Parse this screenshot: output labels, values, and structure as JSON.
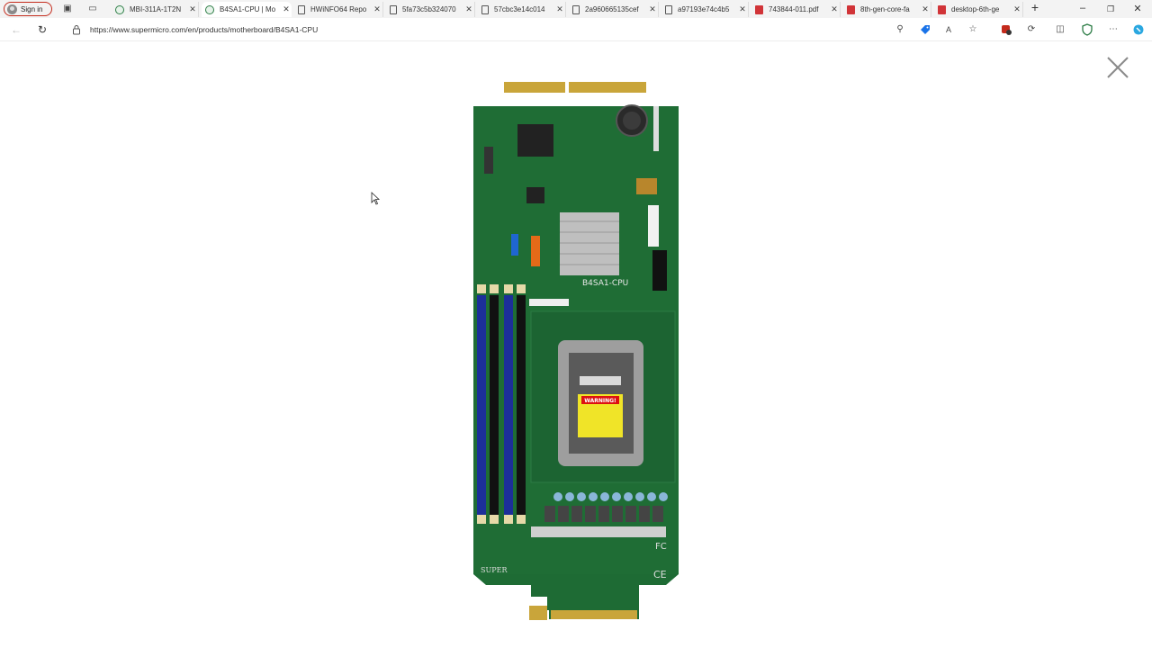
{
  "browser": {
    "signin_label": "Sign in",
    "tabs": [
      {
        "label": "MBI-311A-1T2N",
        "icon": "globe"
      },
      {
        "label": "B4SA1-CPU | Mo",
        "icon": "globe",
        "active": true
      },
      {
        "label": "HWiNFO64 Repo",
        "icon": "doc"
      },
      {
        "label": "5fa73c5b324070",
        "icon": "doc"
      },
      {
        "label": "57cbc3e14c014",
        "icon": "doc"
      },
      {
        "label": "2a960665135cef",
        "icon": "doc"
      },
      {
        "label": "a97193e74c4b5",
        "icon": "doc"
      },
      {
        "label": "743844-011.pdf",
        "icon": "pdf"
      },
      {
        "label": "8th-gen-core-fa",
        "icon": "pdf"
      },
      {
        "label": "desktop-6th-ge",
        "icon": "pdf"
      }
    ],
    "url": "https://www.supermicro.com/en/products/motherboard/B4SA1-CPU"
  },
  "viewer": {
    "board_model": "B4SA1-CPU",
    "warning_text": "WARNING!",
    "brand": "SUPER",
    "fcc_mark": "FC",
    "ce_mark": "CE"
  }
}
